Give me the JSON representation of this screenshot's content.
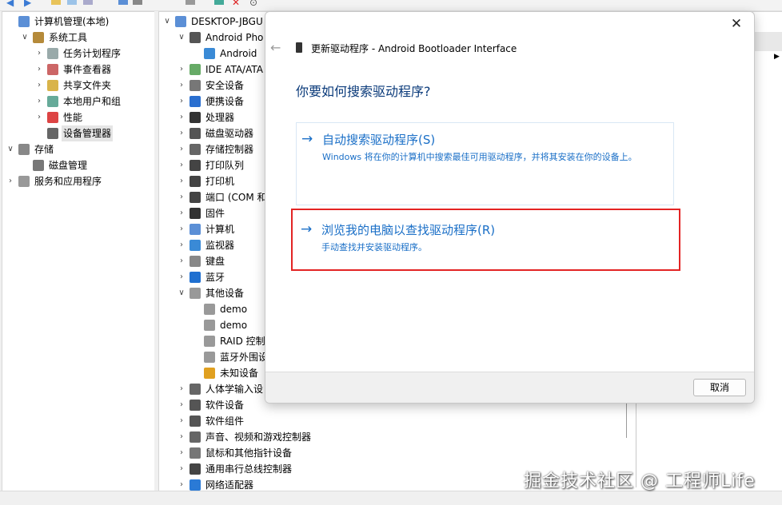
{
  "left_tree": [
    {
      "label": "计算机管理(本地)",
      "icon": "computer-management-icon",
      "level": 0,
      "expander": ""
    },
    {
      "label": "系统工具",
      "icon": "tools-icon",
      "level": 1,
      "expander": "∨"
    },
    {
      "label": "任务计划程序",
      "icon": "clock-icon",
      "level": 2,
      "expander": "›"
    },
    {
      "label": "事件查看器",
      "icon": "event-viewer-icon",
      "level": 2,
      "expander": "›"
    },
    {
      "label": "共享文件夹",
      "icon": "shared-folder-icon",
      "level": 2,
      "expander": "›"
    },
    {
      "label": "本地用户和组",
      "icon": "users-icon",
      "level": 2,
      "expander": "›"
    },
    {
      "label": "性能",
      "icon": "performance-icon",
      "level": 2,
      "expander": "›"
    },
    {
      "label": "设备管理器",
      "icon": "device-manager-icon",
      "level": 2,
      "expander": "",
      "selected": true
    },
    {
      "label": "存储",
      "icon": "storage-icon",
      "level": 0,
      "expander": "∨"
    },
    {
      "label": "磁盘管理",
      "icon": "disk-icon",
      "level": 1,
      "expander": ""
    },
    {
      "label": "服务和应用程序",
      "icon": "services-icon",
      "level": 0,
      "expander": "›"
    }
  ],
  "device_tree": [
    {
      "label": "DESKTOP-JBGU",
      "icon": "computer-icon",
      "level": 0,
      "expander": "∨"
    },
    {
      "label": "Android Pho",
      "icon": "phone-icon",
      "level": 1,
      "expander": "∨"
    },
    {
      "label": "Android",
      "icon": "monitor-icon",
      "level": 2,
      "expander": ""
    },
    {
      "label": "IDE ATA/ATA",
      "icon": "ide-icon",
      "level": 1,
      "expander": "›"
    },
    {
      "label": "安全设备",
      "icon": "security-icon",
      "level": 1,
      "expander": "›"
    },
    {
      "label": "便携设备",
      "icon": "portable-icon",
      "level": 1,
      "expander": "›"
    },
    {
      "label": "处理器",
      "icon": "cpu-icon",
      "level": 1,
      "expander": "›"
    },
    {
      "label": "磁盘驱动器",
      "icon": "disk-drive-icon",
      "level": 1,
      "expander": "›"
    },
    {
      "label": "存储控制器",
      "icon": "storage-controller-icon",
      "level": 1,
      "expander": "›"
    },
    {
      "label": "打印队列",
      "icon": "print-queue-icon",
      "level": 1,
      "expander": "›"
    },
    {
      "label": "打印机",
      "icon": "printer-icon",
      "level": 1,
      "expander": "›"
    },
    {
      "label": "端口 (COM 和",
      "icon": "port-icon",
      "level": 1,
      "expander": "›"
    },
    {
      "label": "固件",
      "icon": "firmware-icon",
      "level": 1,
      "expander": "›"
    },
    {
      "label": "计算机",
      "icon": "computer-icon",
      "level": 1,
      "expander": "›"
    },
    {
      "label": "监视器",
      "icon": "monitor-icon",
      "level": 1,
      "expander": "›"
    },
    {
      "label": "键盘",
      "icon": "keyboard-icon",
      "level": 1,
      "expander": "›"
    },
    {
      "label": "蓝牙",
      "icon": "bluetooth-icon",
      "level": 1,
      "expander": "›"
    },
    {
      "label": "其他设备",
      "icon": "unknown-device-icon",
      "level": 1,
      "expander": "∨"
    },
    {
      "label": "demo",
      "icon": "unknown-device-icon",
      "level": 2,
      "expander": ""
    },
    {
      "label": "demo",
      "icon": "unknown-device-icon",
      "level": 2,
      "expander": ""
    },
    {
      "label": "RAID 控制",
      "icon": "unknown-device-icon",
      "level": 2,
      "expander": ""
    },
    {
      "label": "蓝牙外围设",
      "icon": "unknown-device-icon",
      "level": 2,
      "expander": ""
    },
    {
      "label": "未知设备",
      "icon": "warning-device-icon",
      "level": 2,
      "expander": ""
    },
    {
      "label": "人体学输入设",
      "icon": "hid-icon",
      "level": 1,
      "expander": "›"
    },
    {
      "label": "软件设备",
      "icon": "software-device-icon",
      "level": 1,
      "expander": "›"
    },
    {
      "label": "软件组件",
      "icon": "software-component-icon",
      "level": 1,
      "expander": "›"
    },
    {
      "label": "声音、视频和游戏控制器",
      "icon": "sound-icon",
      "level": 1,
      "expander": "›"
    },
    {
      "label": "鼠标和其他指针设备",
      "icon": "mouse-icon",
      "level": 1,
      "expander": "›"
    },
    {
      "label": "通用串行总线控制器",
      "icon": "usb-icon",
      "level": 1,
      "expander": "›"
    },
    {
      "label": "网络适配器",
      "icon": "network-icon",
      "level": 1,
      "expander": "›"
    }
  ],
  "dialog": {
    "title": "更新驱动程序 - Android Bootloader Interface",
    "heading": "你要如何搜索驱动程序?",
    "close_glyph": "✕",
    "back_glyph": "←",
    "option_auto": {
      "arrow": "→",
      "title": "自动搜索驱动程序(S)",
      "desc": "Windows 将在你的计算机中搜索最佳可用驱动程序，并将其安装在你的设备上。"
    },
    "option_browse": {
      "arrow": "→",
      "title": "浏览我的电脑以查找驱动程序(R)",
      "desc": "手动查找并安装驱动程序。"
    },
    "cancel_label": "取消"
  },
  "watermark": "掘金技术社区 @ 工程师Life",
  "colors": {
    "link_blue": "#1a6fc7",
    "highlight_red": "#e32424",
    "heading_blue": "#0a3a7a"
  }
}
